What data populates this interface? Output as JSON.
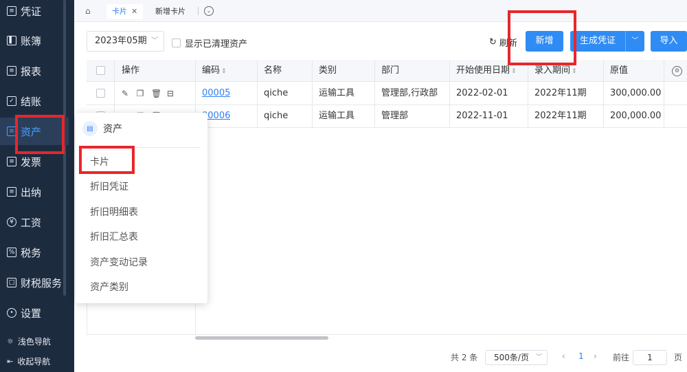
{
  "sidebar": {
    "items": [
      {
        "label": "凭证",
        "icon": "voucher-icon"
      },
      {
        "label": "账簿",
        "icon": "ledger-icon"
      },
      {
        "label": "报表",
        "icon": "report-icon"
      },
      {
        "label": "结账",
        "icon": "checkout-icon"
      },
      {
        "label": "资产",
        "icon": "asset-icon"
      },
      {
        "label": "发票",
        "icon": "invoice-icon"
      },
      {
        "label": "出纳",
        "icon": "cashier-icon"
      },
      {
        "label": "工资",
        "icon": "salary-icon"
      },
      {
        "label": "税务",
        "icon": "tax-icon"
      },
      {
        "label": "财税服务",
        "icon": "service-icon"
      },
      {
        "label": "设置",
        "icon": "gear-icon"
      }
    ],
    "light_nav": "浅色导航",
    "collapse_nav": "收起导航"
  },
  "tabs": [
    {
      "label": "卡片",
      "active": true
    },
    {
      "label": "新增卡片",
      "active": false
    }
  ],
  "toolbar": {
    "period": "2023年05期",
    "show_cleared": "显示已清理资产",
    "refresh": "刷新",
    "new": "新增",
    "generate_voucher": "生成凭证",
    "import": "导入"
  },
  "table": {
    "headers": {
      "ops": "操作",
      "code": "编码",
      "name": "名称",
      "category": "类别",
      "dept": "部门",
      "start_date": "开始使用日期",
      "entry_period": "录入期间",
      "original": "原值"
    },
    "rows": [
      {
        "code": "00005",
        "name": "qiche",
        "category": "运输工具",
        "dept": "管理部,行政部",
        "start_date": "2022-02-01",
        "entry_period": "2022年11期",
        "original": "300,000.00"
      },
      {
        "code": "00006",
        "name": "qiche",
        "category": "运输工具",
        "dept": "管理部",
        "start_date": "2022-11-01",
        "entry_period": "2022年11期",
        "original": "200,000.00"
      }
    ]
  },
  "pagination": {
    "total": "共 2 条",
    "page_size": "500条/页",
    "current": "1",
    "goto_label": "前往",
    "goto_value": "1",
    "goto_unit": "页"
  },
  "popup": {
    "title": "资产",
    "items": [
      "卡片",
      "折旧凭证",
      "折旧明细表",
      "折旧汇总表",
      "资产变动记录",
      "资产类别"
    ]
  },
  "colors": {
    "sidebar_bg": "#1d2b3f",
    "primary": "#2f8cf4",
    "highlight": "#e8262b"
  }
}
